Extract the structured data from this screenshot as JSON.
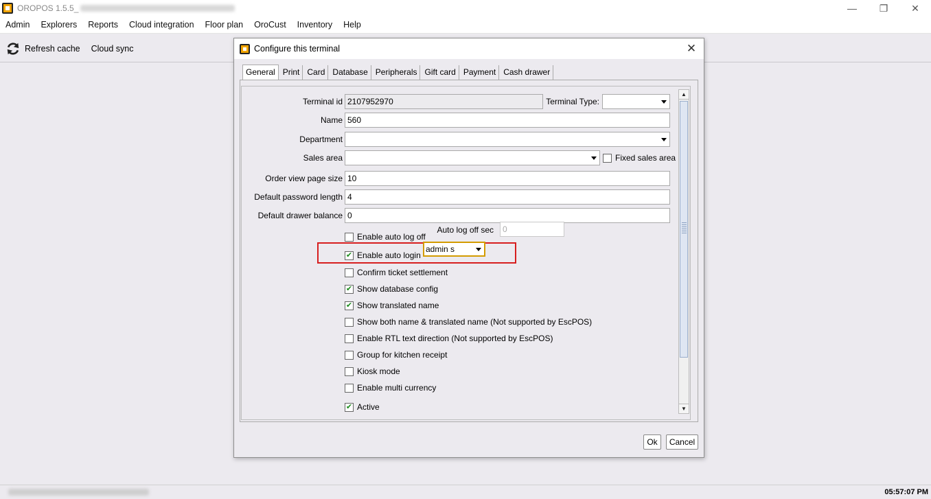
{
  "window": {
    "title": "OROPOS 1.5.5_"
  },
  "menu": [
    "Admin",
    "Explorers",
    "Reports",
    "Cloud integration",
    "Floor plan",
    "OroCust",
    "Inventory",
    "Help"
  ],
  "toolbar": {
    "refresh_label": "Refresh cache",
    "cloud_sync_label": "Cloud sync"
  },
  "status": {
    "time": "05:57:07 PM"
  },
  "dialog": {
    "title": "Configure this terminal",
    "tabs": [
      "General",
      "Print",
      "Card",
      "Database",
      "Peripherals",
      "Gift card",
      "Payment",
      "Cash drawer"
    ],
    "active_tab": "General",
    "fields": {
      "terminal_id_label": "Terminal id",
      "terminal_id_value": "2107952970",
      "terminal_type_label": "Terminal Type:",
      "terminal_type_value": "",
      "name_label": "Name",
      "name_value": "560",
      "department_label": "Department",
      "department_value": "",
      "sales_area_label": "Sales area",
      "sales_area_value": "",
      "fixed_sales_area_label": "Fixed sales area",
      "order_view_label": "Order view page size",
      "order_view_value": "10",
      "password_length_label": "Default password length",
      "password_length_value": "4",
      "drawer_balance_label": "Default drawer balance",
      "drawer_balance_value": "0",
      "auto_logoff_label": "Enable auto log off",
      "auto_logoff_sec_label": "Auto log off sec",
      "auto_logoff_sec_value": "0",
      "auto_login_label": "Enable auto login",
      "auto_login_user": "admin s"
    },
    "options": [
      {
        "label": "Confirm ticket settlement",
        "checked": false
      },
      {
        "label": "Show database config",
        "checked": true
      },
      {
        "label": "Show translated name",
        "checked": true
      },
      {
        "label": "Show both name & translated name (Not supported by EscPOS)",
        "checked": false
      },
      {
        "label": "Enable RTL text direction (Not supported by EscPOS)",
        "checked": false
      },
      {
        "label": "Group for kitchen receipt",
        "checked": false
      },
      {
        "label": "Kiosk mode",
        "checked": false
      },
      {
        "label": "Enable multi currency",
        "checked": false
      },
      {
        "label": "Active",
        "checked": true
      }
    ],
    "checks": {
      "fixed_sales_area": false,
      "auto_logoff": false,
      "auto_login": true
    },
    "ok_label": "Ok",
    "cancel_label": "Cancel"
  },
  "colors": {
    "highlight": "#d71e1e",
    "check": "#1a8a1a",
    "focus": "#d39b00"
  }
}
